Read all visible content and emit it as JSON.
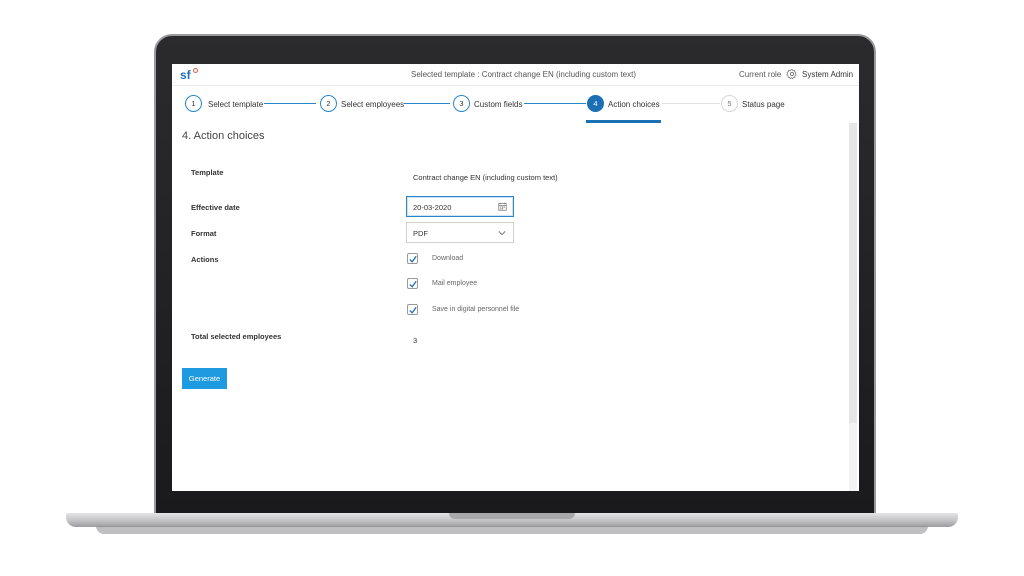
{
  "header": {
    "logo_text": "sf",
    "selected_template": "Selected template : Contract change EN (including custom text)",
    "current_role_label": "Current role",
    "user_role": "System Admin"
  },
  "stepper": {
    "steps": [
      {
        "number": "1",
        "label": "Select template",
        "state": "done"
      },
      {
        "number": "2",
        "label": "Select employees",
        "state": "done"
      },
      {
        "number": "3",
        "label": "Custom fields",
        "state": "done"
      },
      {
        "number": "4",
        "label": "Action choices",
        "state": "active"
      },
      {
        "number": "5",
        "label": "Status page",
        "state": "future"
      }
    ]
  },
  "form": {
    "title": "4. Action choices",
    "template_label": "Template",
    "template_value": "Contract change EN (including custom text)",
    "effective_date_label": "Effective date",
    "effective_date_value": "20-03-2020",
    "format_label": "Format",
    "format_value": "PDF",
    "actions_label": "Actions",
    "actions": [
      {
        "label": "Download",
        "checked": true
      },
      {
        "label": "Mail employee",
        "checked": true
      },
      {
        "label": "Save in digital personnel file",
        "checked": true
      }
    ],
    "total_label": "Total selected employees",
    "total_value": "3",
    "generate_label": "Generate"
  },
  "colors": {
    "primary": "#1b6fb5",
    "button": "#1e9ae0",
    "accent_logo": "#e05a3f"
  }
}
